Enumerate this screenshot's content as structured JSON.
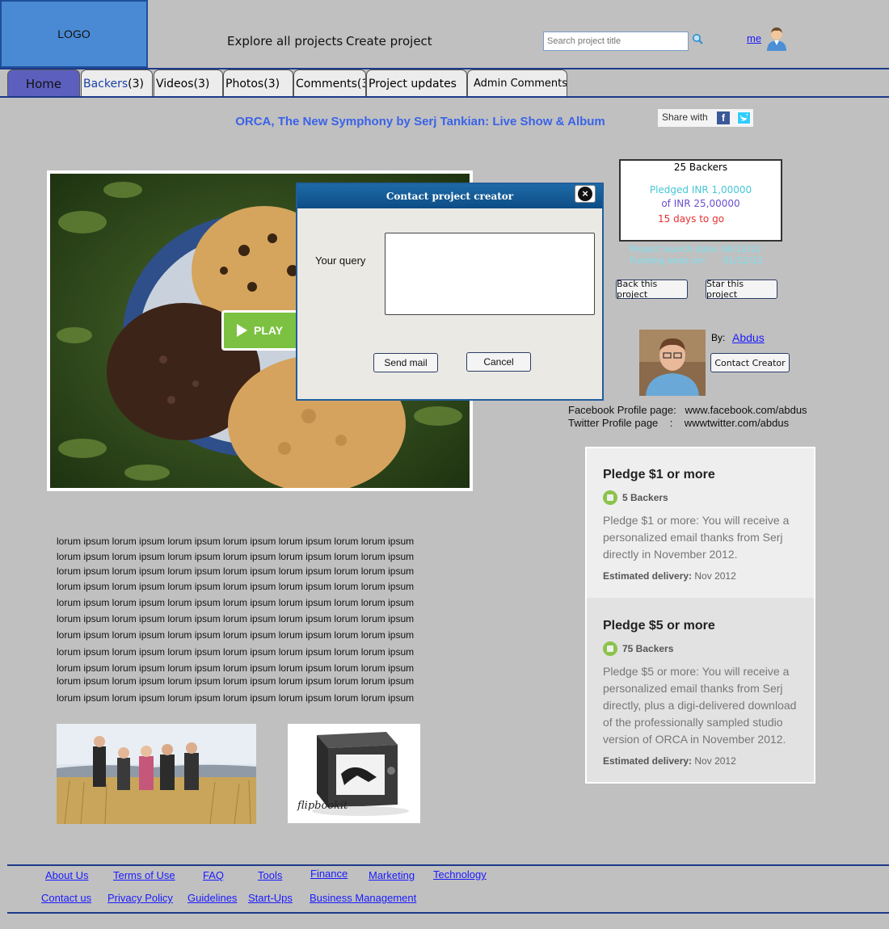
{
  "header": {
    "logo": "LOGO",
    "nav_explore": "Explore all projects",
    "nav_create": "Create project",
    "search_placeholder": "Search project title",
    "user_link": "me"
  },
  "tabs": {
    "home": "Home",
    "backers_word": "Backers",
    "backers_count": "(3)",
    "videos": "Videos(3)",
    "photos": "Photos(3)",
    "comments": "Comments(3",
    "updates": "Project updates",
    "admin": "Admin Comments"
  },
  "project": {
    "title": "ORCA, The New Symphony by Serj Tankian: Live Show & Album",
    "share_label": "Share with",
    "play_label": "PLAY"
  },
  "modal": {
    "title": "Contact project creator",
    "query_label": "Your query",
    "send_label": "Send mail",
    "cancel_label": "Cancel"
  },
  "stats": {
    "backers": "25 Backers",
    "pledged": "Pledged INR 1,00000",
    "goal": "of INR 25,00000",
    "days_left": "15 days to go",
    "launch_date": "Project launch date: 06/12/12",
    "funding_ends": "Funding ends on:      01/12/12",
    "back_button": "Back this project",
    "star_button": "Star this project"
  },
  "creator": {
    "by_label": "By:",
    "name": "Abdus",
    "contact_button": "Contact Creator",
    "facebook_line": "Facebook Profile page:   www.facebook.com/abdus",
    "twitter_line": "Twitter Profile page    :    wwwtwitter.com/abdus"
  },
  "pledges": [
    {
      "title": "Pledge $1 or more",
      "backers": "5 Backers",
      "description": "Pledge $1 or more: You will receive a personalized email thanks from Serj directly in November 2012.",
      "delivery_label": "Estimated delivery:",
      "delivery_value": "Nov 2012"
    },
    {
      "title": "Pledge $5 or more",
      "backers": "75 Backers",
      "description": "Pledge $5 or more: You will receive a personalized email thanks from Serj directly, plus a digi-delivered download of the professionally sampled studio version of ORCA in November 2012.",
      "delivery_label": "Estimated delivery:",
      "delivery_value": "Nov 2012"
    }
  ],
  "lorem_line": "lorum ipsum lorum ipsum lorum ipsum lorum ipsum lorum ipsum lorum lorum ipsum",
  "thumb_caption": "flipbookit",
  "footer": {
    "about": "About Us",
    "terms": "Terms of Use",
    "faq": "FAQ",
    "tools": "Tools",
    "finance": "Finance",
    "marketing": "Marketing",
    "technology": "Technology",
    "contact": "Contact us",
    "privacy": "Privacy Policy",
    "guidelines": "Guidelines",
    "startups": "Start-Ups",
    "business": "Business Management"
  },
  "colors": {
    "page_bg": "#c0c0c0",
    "title_blue": "#3a63e8",
    "pledged_teal": "#45c6d6",
    "goal_purple": "#6b4fcf",
    "days_red": "#e53030",
    "home_tab": "#5d5fbf",
    "link_blue": "#1a1aff",
    "play_green": "#7cc142"
  },
  "icons": {
    "search": "search-icon",
    "user": "user-avatar-icon",
    "facebook": "facebook-icon",
    "twitter": "twitter-icon",
    "close": "close-icon",
    "play": "play-icon",
    "badge": "backer-badge-icon"
  }
}
